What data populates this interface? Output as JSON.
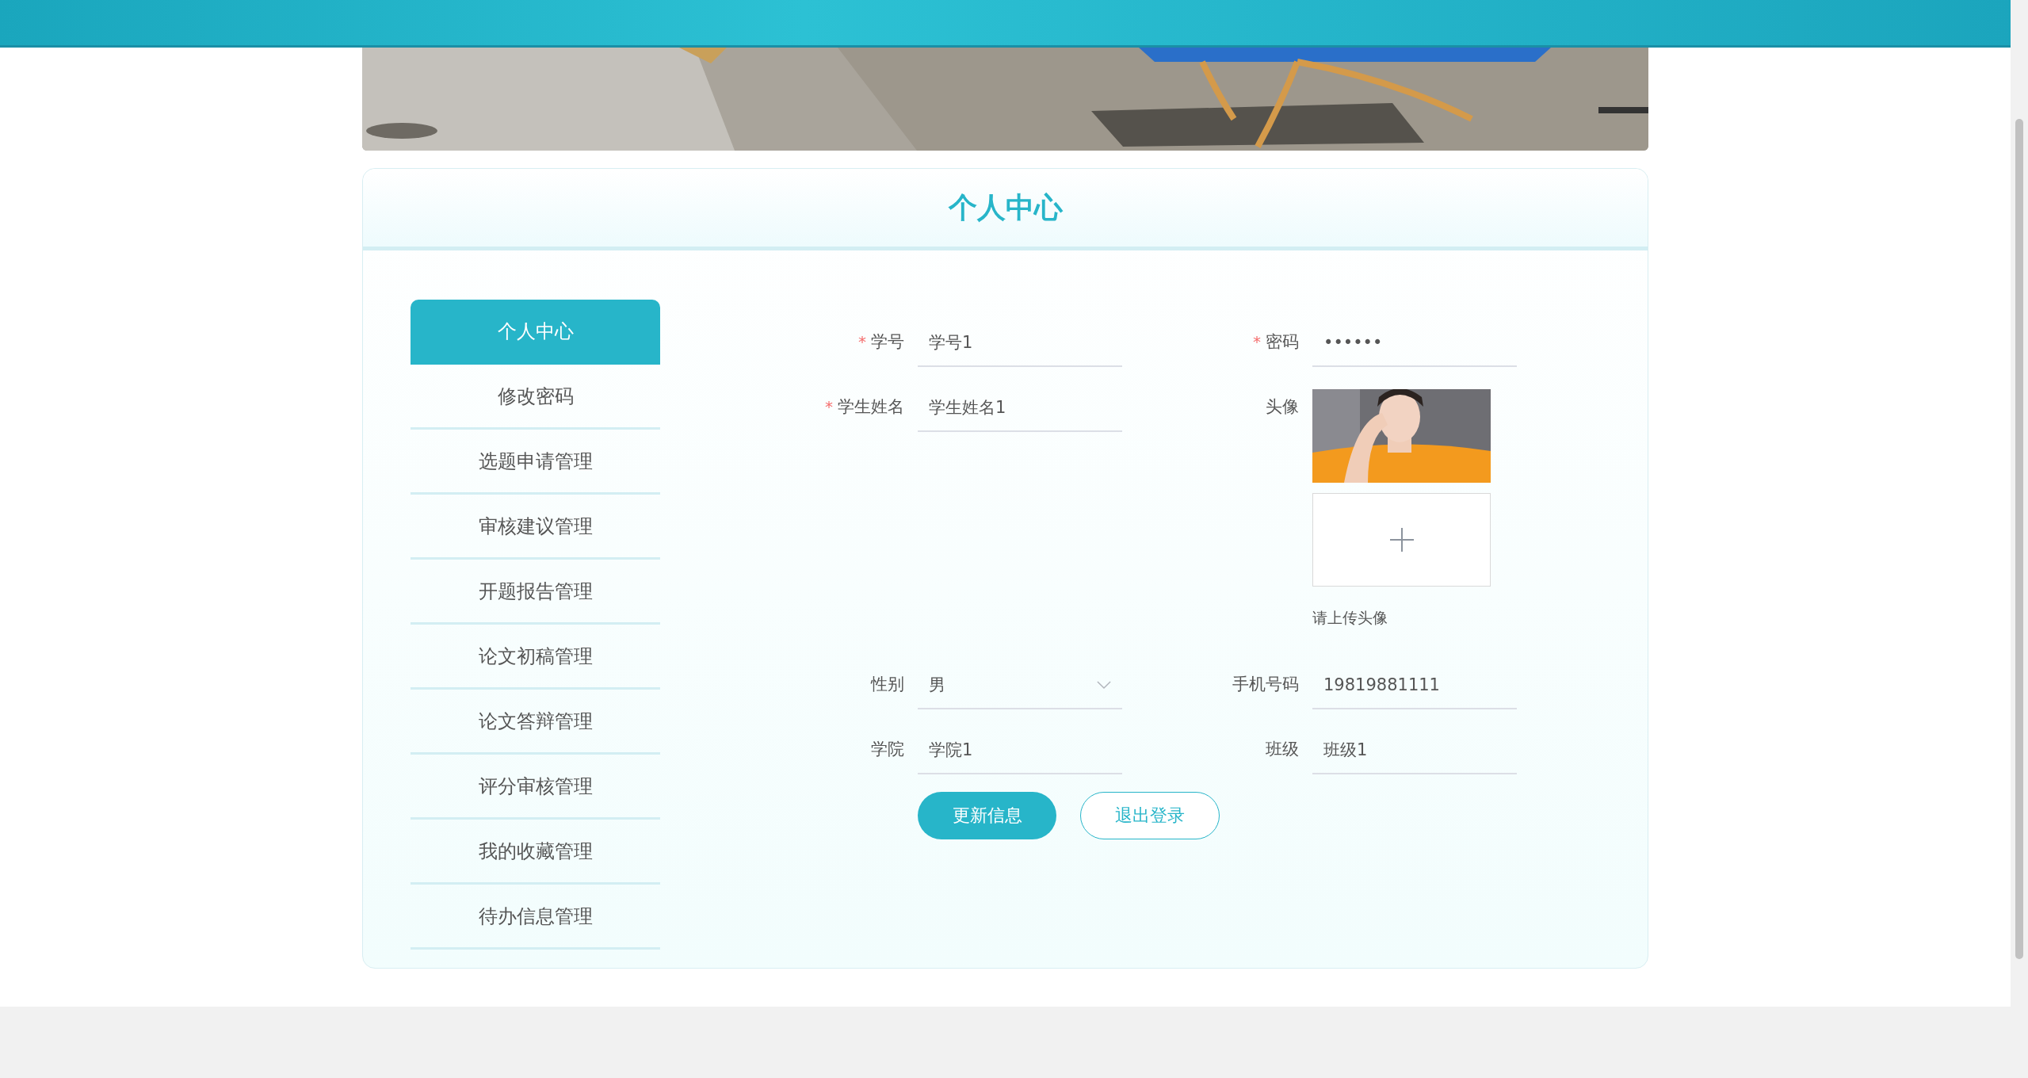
{
  "title": "个人中心",
  "menu": [
    {
      "label": "个人中心",
      "selected": true
    },
    {
      "label": "修改密码",
      "selected": false
    },
    {
      "label": "选题申请管理",
      "selected": false
    },
    {
      "label": "审核建议管理",
      "selected": false
    },
    {
      "label": "开题报告管理",
      "selected": false
    },
    {
      "label": "论文初稿管理",
      "selected": false
    },
    {
      "label": "论文答辩管理",
      "selected": false
    },
    {
      "label": "评分审核管理",
      "selected": false
    },
    {
      "label": "我的收藏管理",
      "selected": false
    },
    {
      "label": "待办信息管理",
      "selected": false
    }
  ],
  "fields": [
    {
      "kind": "text",
      "label": "学号",
      "required_mark": "*",
      "value": "学号1"
    },
    {
      "kind": "password",
      "label": "密码",
      "required_mark": "*",
      "value": "••••••"
    },
    {
      "kind": "text",
      "label": "学生姓名",
      "required_mark": "*",
      "value": "学生姓名1"
    },
    {
      "kind": "avatar",
      "label": "头像",
      "hint": "请上传头像"
    },
    {
      "kind": "select",
      "label": "性别",
      "value": "男"
    },
    {
      "kind": "text",
      "label": "手机号码",
      "value": "19819881111"
    },
    {
      "kind": "text",
      "label": "学院",
      "value": "学院1"
    },
    {
      "kind": "text",
      "label": "班级",
      "value": "班级1"
    }
  ],
  "buttons": [
    {
      "label": "更新信息",
      "kind": "primary"
    },
    {
      "label": "退出登录",
      "kind": "outline"
    }
  ]
}
